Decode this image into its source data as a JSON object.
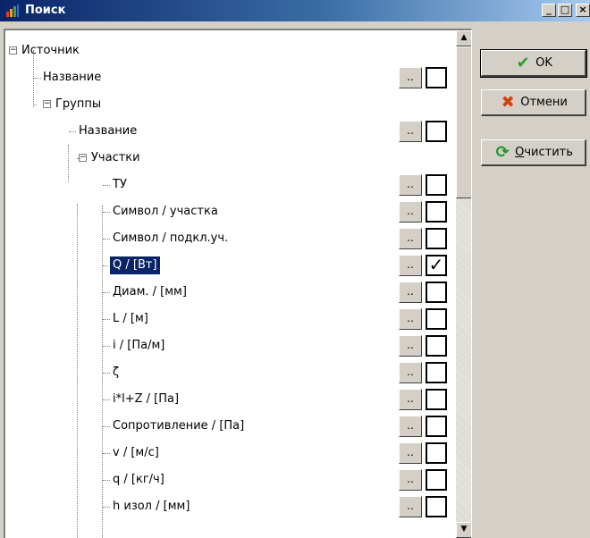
{
  "window": {
    "title": "Поиск",
    "min_glyph": "_",
    "max_glyph": "□",
    "close_glyph": "×"
  },
  "buttons": {
    "ok": "OK",
    "cancel": "Отмени",
    "clear_underlined": "О",
    "clear_rest": "чистить"
  },
  "tree": [
    {
      "label": "Источник",
      "has_button": false,
      "checked": false,
      "selected": false
    },
    {
      "label": "Название",
      "has_button": true,
      "checked": false,
      "selected": false
    },
    {
      "label": "Группы",
      "has_button": false,
      "checked": false,
      "selected": false
    },
    {
      "label": "Название",
      "has_button": true,
      "checked": false,
      "selected": false
    },
    {
      "label": "Участки",
      "has_button": false,
      "checked": false,
      "selected": false
    },
    {
      "label": "ТУ",
      "has_button": true,
      "checked": false,
      "selected": false
    },
    {
      "label": "Символ / участка",
      "has_button": true,
      "checked": false,
      "selected": false
    },
    {
      "label": "Символ / подкл.уч.",
      "has_button": true,
      "checked": false,
      "selected": false
    },
    {
      "label": "Q / [Вт]",
      "has_button": true,
      "checked": true,
      "selected": true
    },
    {
      "label": "Диам. / [мм]",
      "has_button": true,
      "checked": false,
      "selected": false
    },
    {
      "label": "L / [м]",
      "has_button": true,
      "checked": false,
      "selected": false
    },
    {
      "label": "i / [Па/м]",
      "has_button": true,
      "checked": false,
      "selected": false
    },
    {
      "label": "ζ",
      "has_button": true,
      "checked": false,
      "selected": false
    },
    {
      "label": "i*l+Z / [Па]",
      "has_button": true,
      "checked": false,
      "selected": false
    },
    {
      "label": "Сопротивление / [Па]",
      "has_button": true,
      "checked": false,
      "selected": false
    },
    {
      "label": "v / [м/с]",
      "has_button": true,
      "checked": false,
      "selected": false
    },
    {
      "label": "q / [кг/ч]",
      "has_button": true,
      "checked": false,
      "selected": false
    },
    {
      "label": "h изол / [мм]",
      "has_button": true,
      "checked": false,
      "selected": false
    }
  ],
  "tree_button_label": "..",
  "check_glyph": "✓",
  "expander_glyph": "−",
  "scroll": {
    "up_glyph": "▲",
    "down_glyph": "▼"
  },
  "icons": {
    "ok": "checkmark-icon",
    "cancel": "cross-icon",
    "clear": "refresh-icon"
  },
  "colors": {
    "title_bar": "#0a246a",
    "selection": "#0a246a",
    "face": "#d4d0c8"
  }
}
